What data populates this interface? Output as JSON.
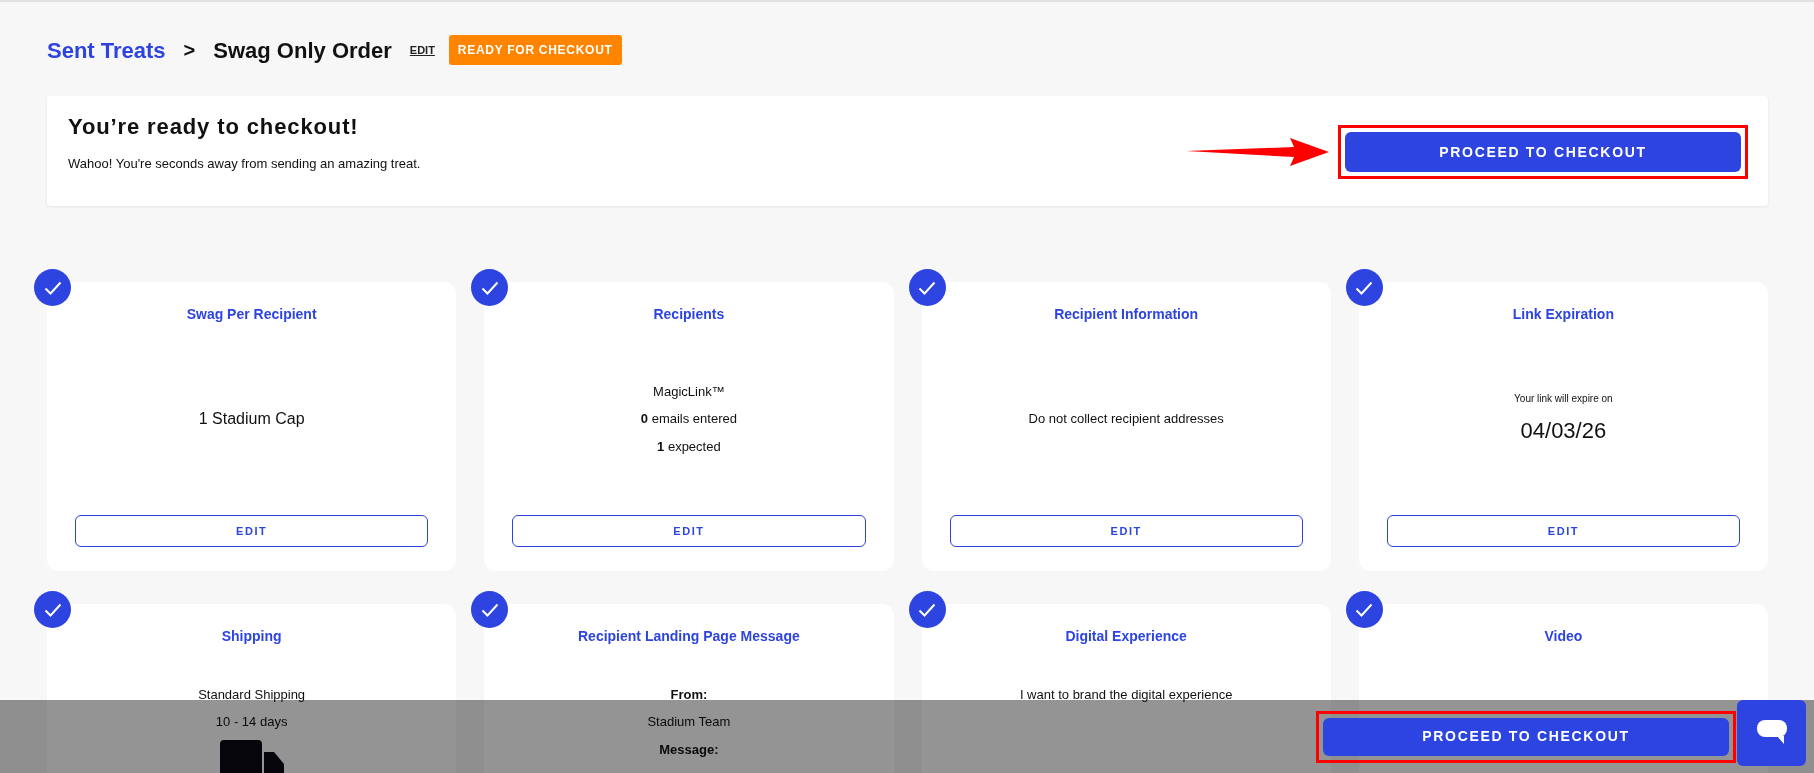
{
  "breadcrumb": {
    "parent": "Sent Treats",
    "separator": ">",
    "current": "Swag Only Order",
    "edit_link": "EDIT",
    "status_badge": "READY FOR CHECKOUT"
  },
  "ready_panel": {
    "title": "You’re ready to checkout!",
    "message": "Wahoo! You're seconds away from sending an amazing treat.",
    "button": {
      "label": "PROCEED TO CHECKOUT",
      "highlighted": true
    },
    "pointer_arrow": true
  },
  "steps": [
    {
      "title": "Swag Per Recipient",
      "complete": true,
      "lines": [
        {
          "kind": "large",
          "text": "1 Stadium Cap"
        }
      ],
      "edit_button": "EDIT"
    },
    {
      "title": "Recipients",
      "complete": true,
      "lines": [
        {
          "kind": "plain",
          "text": "MagicLink™"
        },
        {
          "kind": "plain",
          "text": "**0** emails entered"
        },
        {
          "kind": "plain",
          "text": "**1** expected"
        }
      ],
      "edit_button": "EDIT"
    },
    {
      "title": "Recipient Information",
      "complete": true,
      "lines": [
        {
          "kind": "plain",
          "text": "Do not collect recipient addresses"
        }
      ],
      "edit_button": "EDIT"
    },
    {
      "title": "Link Expiration",
      "complete": true,
      "lines": [
        {
          "kind": "small",
          "text": "Your link will expire on"
        },
        {
          "kind": "date",
          "text": "04/03/26"
        }
      ],
      "edit_button": "EDIT"
    },
    {
      "title": "Shipping",
      "complete": true,
      "lines": [
        {
          "kind": "plain",
          "text": "Standard Shipping"
        },
        {
          "kind": "plain",
          "text": "10 - 14 days"
        },
        {
          "kind": "truck"
        }
      ]
    },
    {
      "title": "Recipient Landing Page Message",
      "complete": true,
      "lines": [
        {
          "kind": "label",
          "text": "From:"
        },
        {
          "kind": "plain",
          "text": "Stadium Team"
        },
        {
          "kind": "label",
          "text": "Message:"
        }
      ]
    },
    {
      "title": "Digital Experience",
      "complete": true,
      "lines": [
        {
          "kind": "plain",
          "text": "I want to brand the digital experience"
        }
      ]
    },
    {
      "title": "Video",
      "complete": true
    }
  ],
  "bottom_bar": {
    "button": {
      "label": "PROCEED TO CHECKOUT",
      "highlighted": true
    }
  }
}
